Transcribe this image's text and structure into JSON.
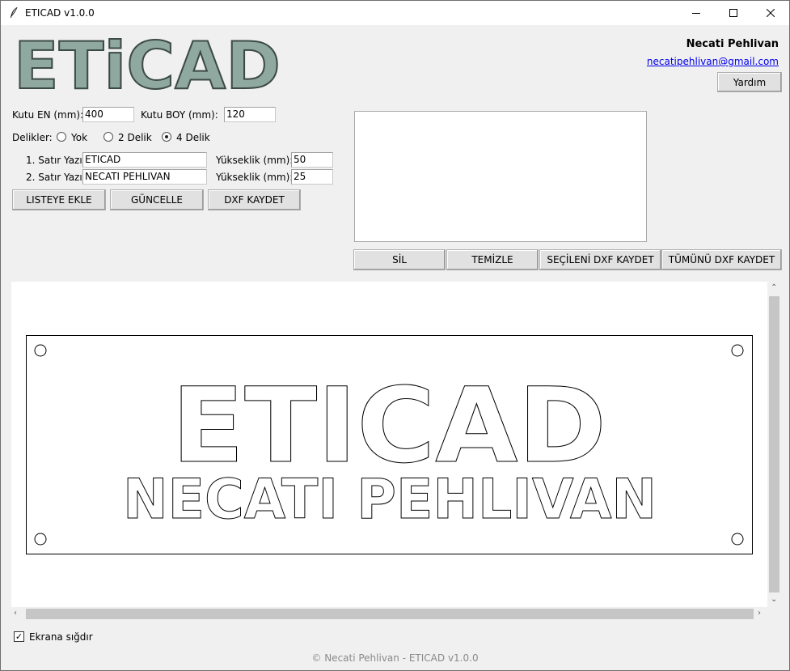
{
  "window": {
    "title": "ETICAD v1.0.0",
    "controls": [
      "minimize",
      "maximize",
      "close"
    ]
  },
  "logo": {
    "text": "ETiCAD",
    "color": "#8fa8a0"
  },
  "author": {
    "name": "Necati Pehlivan",
    "email": "necatipehlivan@gmail.com",
    "help_label": "Yardım"
  },
  "form": {
    "width_label": "Kutu EN (mm):",
    "width_value": "400",
    "height_label": "Kutu BOY (mm):",
    "height_value": "120",
    "holes_label": "Delikler:",
    "holes_options": [
      "Yok",
      "2 Delik",
      "4 Delik"
    ],
    "holes_selected": "4 Delik",
    "line1_label": "1. Satır Yazı:",
    "line1_value": "ETICAD",
    "line1_height_label": "Yükseklik (mm):",
    "line1_height_value": "50",
    "line2_label": "2. Satır Yazı:",
    "line2_value": "NECATI PEHLIVAN",
    "line2_height_label": "Yükseklik (mm):",
    "line2_height_value": "25"
  },
  "buttons": {
    "add": "LISTEYE EKLE",
    "update": "GÜNCELLE",
    "save_dxf": "DXF KAYDET",
    "delete": "SİL",
    "clear": "TEMİZLE",
    "save_selected": "SEÇİLENİ DXF KAYDET",
    "save_all": "TÜMÜNÜ DXF KAYDET"
  },
  "preview": {
    "line1": "ETICAD",
    "line2": "NECATI PEHLIVAN",
    "holes": 4
  },
  "fit_to_screen": {
    "label": "Ekrana sığdır",
    "checked": true
  },
  "footer": "© Necati Pehlivan - ETICAD v1.0.0"
}
